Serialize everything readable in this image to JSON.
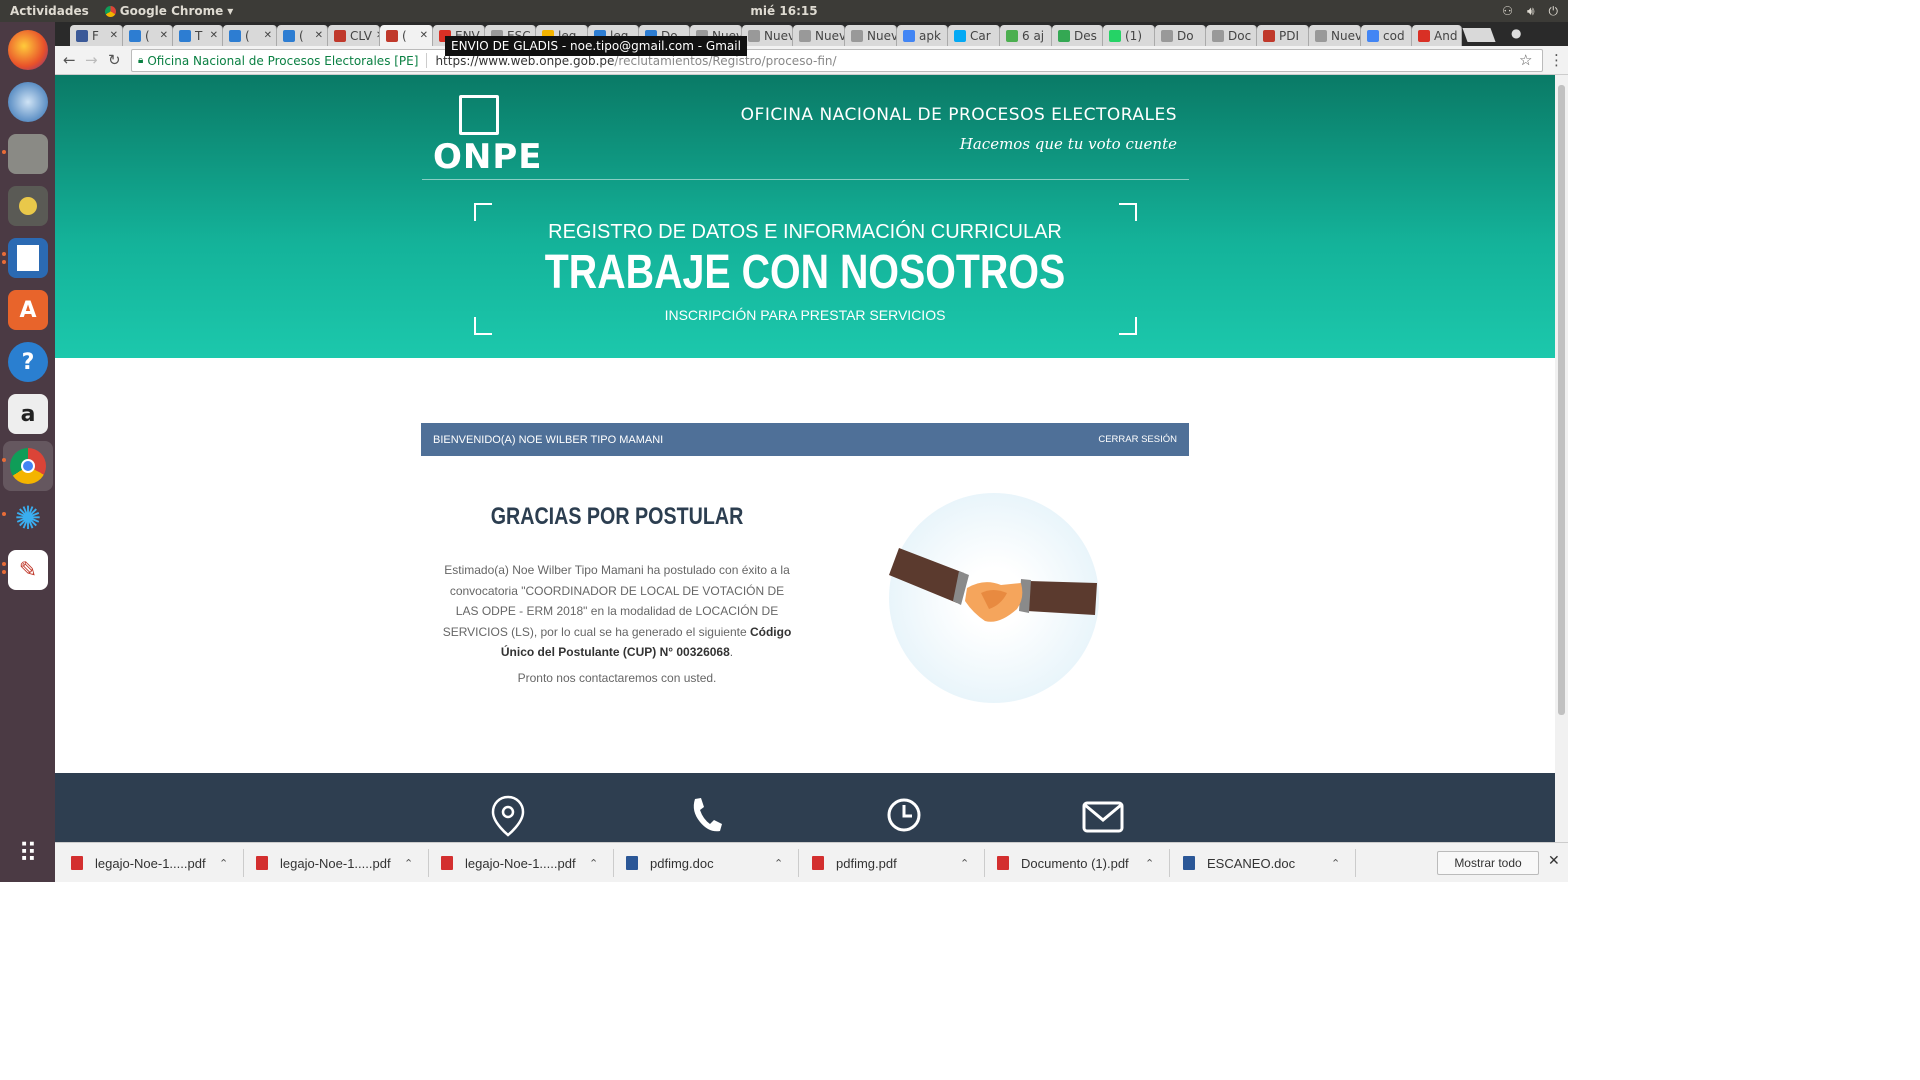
{
  "os": {
    "activities": "Actividades",
    "app_name": "Google Chrome",
    "clock": "mié 16:15"
  },
  "tabs": [
    {
      "label": "F",
      "color": "#3b5998"
    },
    {
      "label": "(",
      "color": "#2d7dd2"
    },
    {
      "label": "T",
      "color": "#2d7dd2"
    },
    {
      "label": "(",
      "color": "#2d7dd2"
    },
    {
      "label": "(",
      "color": "#2d7dd2"
    },
    {
      "label": "CLV",
      "color": "#c0392b"
    },
    {
      "label": "(",
      "color": "#c0392b",
      "active": true
    },
    {
      "label": "ENV",
      "color": "#d93025"
    },
    {
      "label": "ESC",
      "color": "#999"
    },
    {
      "label": "leg",
      "color": "#f4b400"
    },
    {
      "label": "leg",
      "color": "#2d7dd2"
    },
    {
      "label": "Do",
      "color": "#2d7dd2"
    },
    {
      "label": "Nueva",
      "color": "#999"
    },
    {
      "label": "Nueva",
      "color": "#999"
    },
    {
      "label": "Nueva",
      "color": "#999"
    },
    {
      "label": "Nueva",
      "color": "#999"
    },
    {
      "label": "apk",
      "color": "#4285f4"
    },
    {
      "label": "Car",
      "color": "#03a9f4"
    },
    {
      "label": "6 aj",
      "color": "#4caf50"
    },
    {
      "label": "Des",
      "color": "#34a853"
    },
    {
      "label": "(1)",
      "color": "#25d366"
    },
    {
      "label": "Do",
      "color": "#999"
    },
    {
      "label": "Doc",
      "color": "#999"
    },
    {
      "label": "PDI",
      "color": "#c0392b"
    },
    {
      "label": "Nueva",
      "color": "#999"
    },
    {
      "label": "cod",
      "color": "#4285f4"
    },
    {
      "label": "And",
      "color": "#d93025"
    }
  ],
  "tooltip": "ENVIO DE GLADIS - noe.tipo@gmail.com - Gmail",
  "address": {
    "site_name": "Oficina Nacional de Procesos Electorales [PE]",
    "url_host": "https://www.web.onpe.gob.pe",
    "url_path": "/reclutamientos/Registro/proceso-fin/"
  },
  "header": {
    "logo_text": "ONPE",
    "org_name": "OFICINA NACIONAL DE PROCESOS ELECTORALES",
    "slogan": "Hacemos que tu voto cuente",
    "registro": "REGISTRO DE DATOS E INFORMACIÓN CURRICULAR",
    "title": "TRABAJE CON NOSOTROS",
    "subtitle": "INSCRIPCIÓN PARA PRESTAR SERVICIOS"
  },
  "welcome": {
    "text": "BIENVENIDO(A) NOE WILBER TIPO MAMANI",
    "logout": "CERRAR SESIÓN"
  },
  "thanks": {
    "title": "GRACIAS POR POSTULAR",
    "body": "Estimado(a) Noe Wilber Tipo Mamani ha postulado con éxito a la convocatoria \"COORDINADOR DE LOCAL DE VOTACIÓN DE LAS ODPE - ERM 2018\" en la modalidad de LOCACIÓN DE SERVICIOS (LS), por lo cual se ha generado el siguiente",
    "code": "Código Único del Postulante (CUP) N° 00326068",
    "code_suffix": ".",
    "contact": "Pronto nos contactaremos con usted."
  },
  "downloads": [
    {
      "name": "legajo-Noe-1.....pdf",
      "type": "pdf"
    },
    {
      "name": "legajo-Noe-1.....pdf",
      "type": "pdf"
    },
    {
      "name": "legajo-Noe-1.....pdf",
      "type": "pdf"
    },
    {
      "name": "pdfimg.doc",
      "type": "doc"
    },
    {
      "name": "pdfimg.pdf",
      "type": "pdf"
    },
    {
      "name": "Documento (1).pdf",
      "type": "pdf"
    },
    {
      "name": "ESCANEO.doc",
      "type": "doc"
    }
  ],
  "download_bar": {
    "show_all": "Mostrar todo"
  },
  "colors": {
    "hero_top": "#0a7a66",
    "hero_bottom": "#1cc8ac",
    "welcome_bar": "#4f7098",
    "footer": "#2e3e50"
  }
}
